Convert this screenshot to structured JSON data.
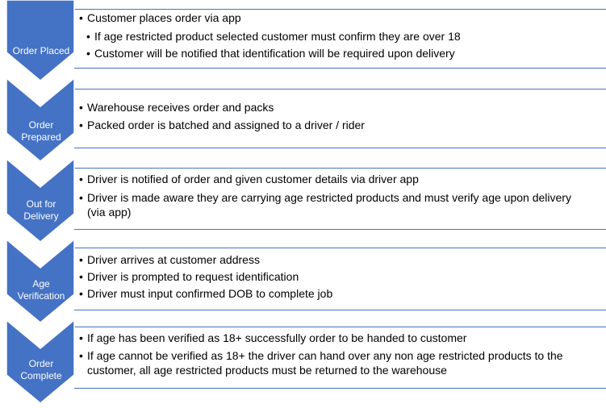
{
  "colors": {
    "accent": "#4472c4",
    "box_border": "#4472c4"
  },
  "steps": [
    {
      "label": "Order Placed",
      "bullets": [
        {
          "text": "Customer places order via app",
          "level": 1
        },
        {
          "text": "If age restricted product selected customer must confirm they are over 18",
          "level": 2
        },
        {
          "text": "Customer will be notified that identification will be required upon delivery",
          "level": 2
        }
      ]
    },
    {
      "label": "Order Prepared",
      "bullets": [
        {
          "text": "Warehouse receives order and packs",
          "level": 1
        },
        {
          "text": "Packed order is batched and assigned to a driver / rider",
          "level": 1
        }
      ]
    },
    {
      "label": "Out for Delivery",
      "bullets": [
        {
          "text": "Driver is notified of order and given customer details via driver app",
          "level": 1
        },
        {
          "text": "Driver is made aware they are carrying age restricted products and must verify age upon delivery",
          "continuation": "(via app)",
          "level": 1
        }
      ]
    },
    {
      "label": "Age Verification",
      "bullets": [
        {
          "text": "Driver arrives at customer address",
          "level": 1
        },
        {
          "text": "Driver is prompted to request identification",
          "level": 1
        },
        {
          "text": "Driver must input confirmed DOB to complete job",
          "level": 1
        }
      ]
    },
    {
      "label": "Order Complete",
      "bullets": [
        {
          "text": "If age has been verified as 18+ successfully order to be handed to customer",
          "level": 1
        },
        {
          "text": "If age cannot be verified as 18+ the driver can hand over any non age restricted products to the",
          "continuation": "customer, all age restricted products must be returned to the warehouse",
          "level": 1
        }
      ]
    }
  ]
}
